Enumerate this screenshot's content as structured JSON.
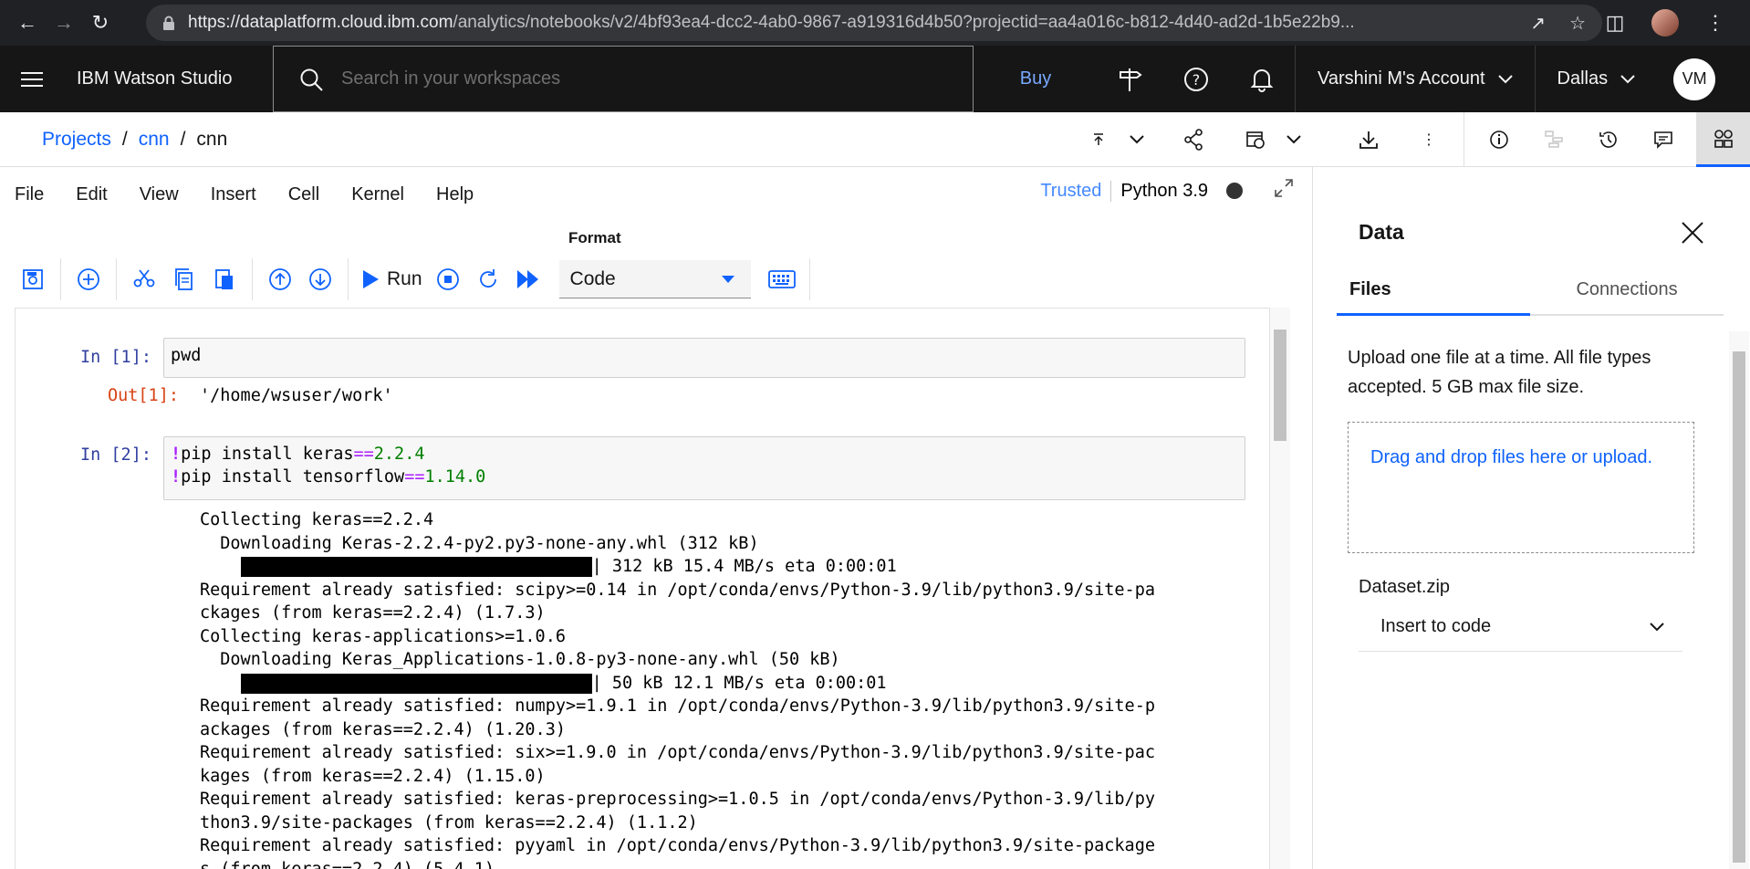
{
  "browser": {
    "url_host": "https://dataplatform.cloud.ibm.com",
    "url_path": "/analytics/notebooks/v2/4bf93ea4-dcc2-4ab0-9867-a919316d4b50?projectid=aa4a016c-b812-4d40-ad2d-1b5e22b9..."
  },
  "header": {
    "brand": "IBM Watson Studio",
    "search_placeholder": "Search in your workspaces",
    "buy": "Buy",
    "account": "Varshini M's Account",
    "region": "Dallas",
    "avatar_initials": "VM"
  },
  "breadcrumb": {
    "items": [
      "Projects",
      "cnn",
      "cnn"
    ],
    "sep": "/"
  },
  "notebook_menu": {
    "items": [
      "File",
      "Edit",
      "View",
      "Insert",
      "Cell",
      "Kernel",
      "Help"
    ],
    "trusted": "Trusted",
    "kernel": "Python 3.9"
  },
  "toolbar": {
    "format_label": "Format",
    "run_label": "Run",
    "cell_type": "Code"
  },
  "cells": {
    "c1": {
      "in_prompt": "In [1]:",
      "code": "pwd",
      "out_prompt": "Out[1]:",
      "out": "'/home/wsuser/work'"
    },
    "c2": {
      "in_prompt": "In [2]:",
      "line1": {
        "bang": "!",
        "cmd": "pip install keras",
        "op": "==",
        "ver": "2.2.4"
      },
      "line2": {
        "bang": "!",
        "cmd": "pip install tensorflow",
        "op": "==",
        "ver": "1.14.0"
      },
      "out": [
        "Collecting keras==2.2.4",
        "  Downloading Keras-2.2.4-py2.py3-none-any.whl (312 kB)",
        "| 312 kB 15.4 MB/s eta 0:00:01",
        "Requirement already satisfied: scipy>=0.14 in /opt/conda/envs/Python-3.9/lib/python3.9/site-pa",
        "ckages (from keras==2.2.4) (1.7.3)",
        "Collecting keras-applications>=1.0.6",
        "  Downloading Keras_Applications-1.0.8-py3-none-any.whl (50 kB)",
        "| 50 kB 12.1 MB/s eta 0:00:01",
        "Requirement already satisfied: numpy>=1.9.1 in /opt/conda/envs/Python-3.9/lib/python3.9/site-p",
        "ackages (from keras==2.2.4) (1.20.3)",
        "Requirement already satisfied: six>=1.9.0 in /opt/conda/envs/Python-3.9/lib/python3.9/site-pac",
        "kages (from keras==2.2.4) (1.15.0)",
        "Requirement already satisfied: keras-preprocessing>=1.0.5 in /opt/conda/envs/Python-3.9/lib/py",
        "thon3.9/site-packages (from keras==2.2.4) (1.1.2)",
        "Requirement already satisfied: pyyaml in /opt/conda/envs/Python-3.9/lib/python3.9/site-package",
        "s (from keras==2.2.4) (5.4.1)"
      ]
    }
  },
  "panel": {
    "title": "Data",
    "tabs": [
      "Files",
      "Connections"
    ],
    "description": "Upload one file at a time. All file types accepted. 5 GB max file size.",
    "dropzone": "Drag and drop files here or upload.",
    "file_name": "Dataset.zip",
    "insert_label": "Insert to code"
  },
  "colors": {
    "accent": "#0f62fe",
    "header_bg": "#161616",
    "in_prompt": "#303f9f",
    "out_prompt": "#d84315"
  }
}
